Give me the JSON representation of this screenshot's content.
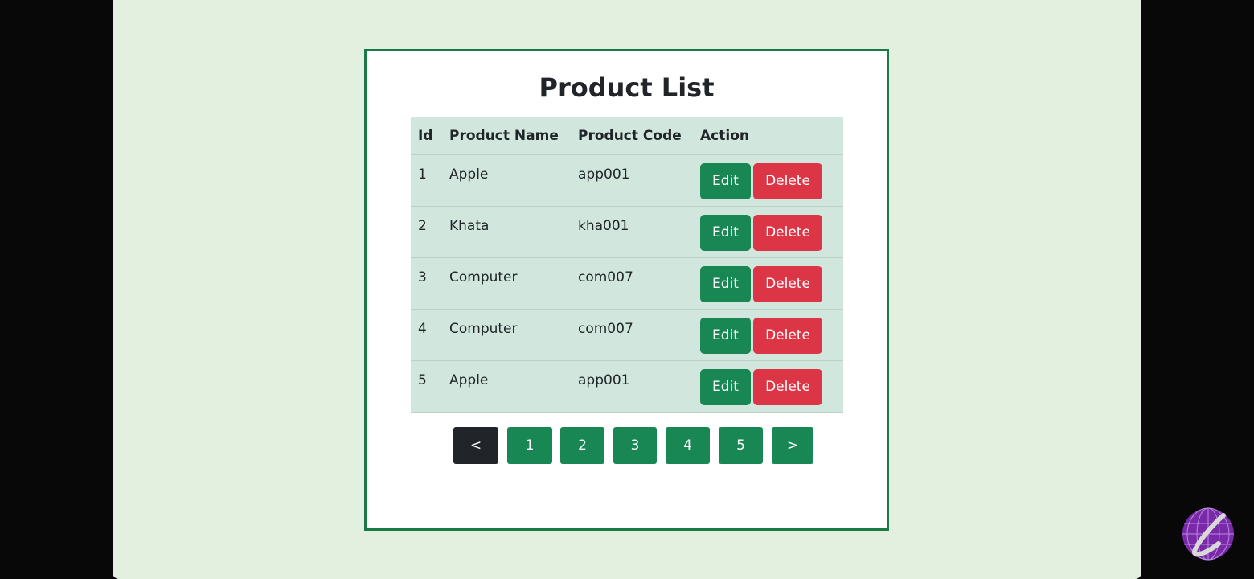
{
  "page": {
    "title": "Product List"
  },
  "table": {
    "headers": [
      "Id",
      "Product Name",
      "Product Code",
      "Action"
    ],
    "rows": [
      {
        "id": "1",
        "name": "Apple",
        "code": "app001"
      },
      {
        "id": "2",
        "name": "Khata",
        "code": "kha001"
      },
      {
        "id": "3",
        "name": "Computer",
        "code": "com007"
      },
      {
        "id": "4",
        "name": "Computer",
        "code": "com007"
      },
      {
        "id": "5",
        "name": "Apple",
        "code": "app001"
      }
    ],
    "edit_label": "Edit",
    "delete_label": "Delete"
  },
  "pagination": {
    "prev": "<",
    "pages": [
      "1",
      "2",
      "3",
      "4",
      "5"
    ],
    "next": ">"
  },
  "colors": {
    "accent": "#198754",
    "danger": "#dc3545",
    "table_bg": "#d1e7dd",
    "border": "#197a45",
    "logo": "#7a2aa8"
  },
  "icons": {
    "logo": "globe-logo-icon"
  }
}
